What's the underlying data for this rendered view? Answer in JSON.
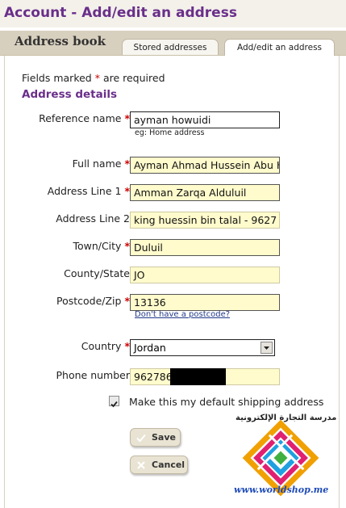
{
  "page_title": "Account - Add/edit an address",
  "address_book_label": "Address book",
  "tabs": [
    {
      "label": "Stored addresses",
      "active": false
    },
    {
      "label": "Add/edit an address",
      "active": true
    }
  ],
  "required_note": {
    "before": "Fields marked ",
    "star": "*",
    "after": " are required"
  },
  "section_title": "Address details",
  "fields": {
    "reference_name": {
      "label": "Reference name",
      "required": true,
      "value": "ayman howuidi",
      "hint": "eg: Home address"
    },
    "full_name": {
      "label": "Full name",
      "required": true,
      "value": "Ayman Ahmad Hussein Abu H"
    },
    "address_line_1": {
      "label": "Address Line 1",
      "required": true,
      "value": "Amman Zarqa Alduluil"
    },
    "address_line_2": {
      "label": "Address Line 2",
      "required": false,
      "value": "king huessin bin talal - 9627"
    },
    "town_city": {
      "label": "Town/City",
      "required": true,
      "value": "Duluil"
    },
    "county_state": {
      "label": "County/State",
      "required": false,
      "value": "JO"
    },
    "postcode_zip": {
      "label": "Postcode/Zip",
      "required": true,
      "value": "13136",
      "link": "Don't have a postcode?"
    },
    "country": {
      "label": "Country",
      "required": true,
      "value": "Jordan"
    },
    "phone_number": {
      "label": "Phone number",
      "required": false,
      "value": "962786"
    }
  },
  "default_shipping": {
    "label": "Make this my default shipping address",
    "checked": true
  },
  "buttons": {
    "save": "Save",
    "cancel": "Cancel"
  },
  "logo": {
    "arabic_text": "مدرسة التجارة الإلكترونية",
    "url": "www.worldshop.me"
  },
  "colors": {
    "title": "#6a2f8a",
    "required_star": "#cc0000",
    "field_highlight": "#fffbcc",
    "tab_bar": "#d8d0be"
  },
  "icons": {
    "save": "check-icon",
    "cancel": "x-icon",
    "country_select": "chevron-down-icon"
  }
}
